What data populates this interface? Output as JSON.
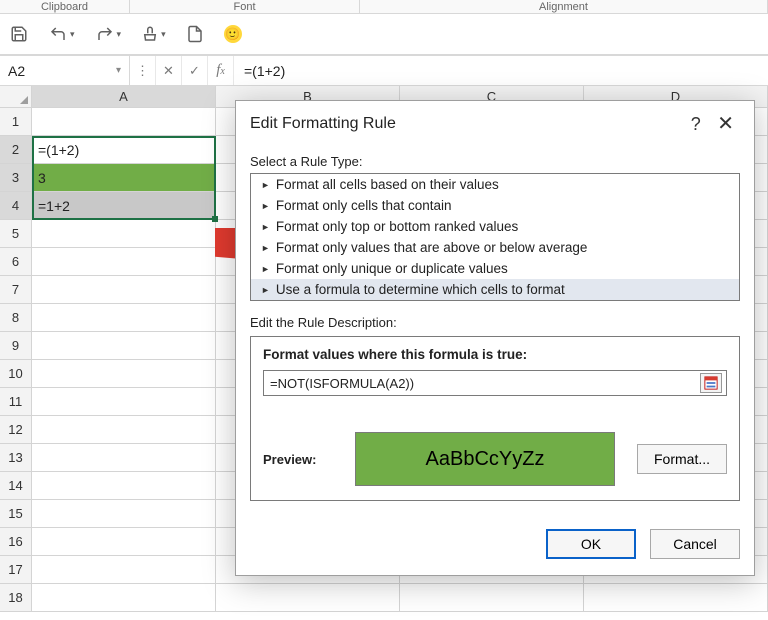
{
  "ribbon_hints": {
    "clipboard": "Clipboard",
    "font": "Font",
    "alignment": "Alignment"
  },
  "namebox": {
    "value": "A2"
  },
  "formula_bar": {
    "value": "=(1+2)"
  },
  "columns": [
    "A",
    "B",
    "C",
    "D"
  ],
  "rows": [
    {
      "n": 1,
      "A": ""
    },
    {
      "n": 2,
      "A": "=(1+2)"
    },
    {
      "n": 3,
      "A": "3"
    },
    {
      "n": 4,
      "A": "=1+2"
    },
    {
      "n": 5,
      "A": ""
    },
    {
      "n": 6,
      "A": ""
    },
    {
      "n": 7,
      "A": ""
    },
    {
      "n": 8,
      "A": ""
    },
    {
      "n": 9,
      "A": ""
    },
    {
      "n": 10,
      "A": ""
    },
    {
      "n": 11,
      "A": ""
    },
    {
      "n": 12,
      "A": ""
    },
    {
      "n": 13,
      "A": ""
    },
    {
      "n": 14,
      "A": ""
    },
    {
      "n": 15,
      "A": ""
    },
    {
      "n": 16,
      "A": ""
    },
    {
      "n": 17,
      "A": ""
    },
    {
      "n": 18,
      "A": ""
    }
  ],
  "selection": {
    "col": "A",
    "row_start": 2,
    "row_end": 4
  },
  "dialog": {
    "title": "Edit Formatting Rule",
    "rule_type_label": "Select a Rule Type:",
    "rule_types": [
      "Format all cells based on their values",
      "Format only cells that contain",
      "Format only top or bottom ranked values",
      "Format only values that are above or below average",
      "Format only unique or duplicate values",
      "Use a formula to determine which cells to format"
    ],
    "rule_type_selected": 5,
    "desc_label": "Edit the Rule Description:",
    "formula_label": "Format values where this formula is true:",
    "formula": "=NOT(ISFORMULA(A2))",
    "preview_label": "Preview:",
    "preview_text": "AaBbCcYyZz",
    "format_btn": "Format...",
    "ok": "OK",
    "cancel": "Cancel"
  }
}
